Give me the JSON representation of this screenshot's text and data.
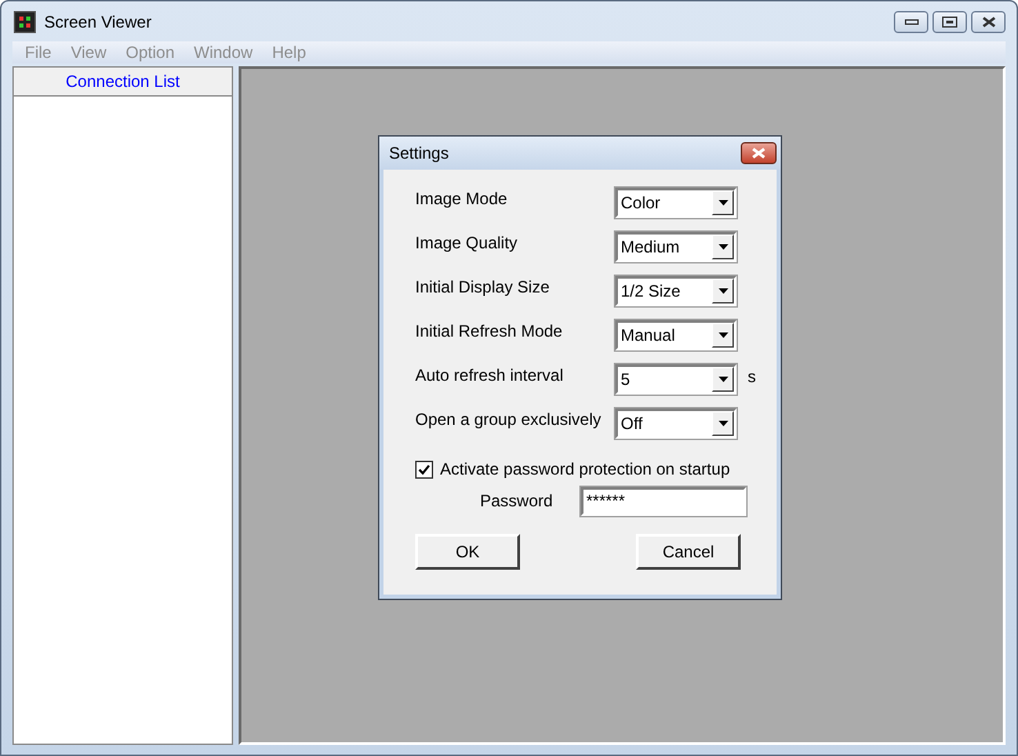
{
  "window": {
    "title": "Screen Viewer"
  },
  "menu": [
    {
      "label": "File",
      "disabled": true
    },
    {
      "label": "View",
      "disabled": true
    },
    {
      "label": "Option",
      "disabled": true
    },
    {
      "label": "Window",
      "disabled": true
    },
    {
      "label": "Help",
      "disabled": true
    }
  ],
  "connection_list": {
    "title": "Connection List"
  },
  "dialog": {
    "title": "Settings",
    "fields": [
      {
        "label": "Image Mode",
        "value": "Color"
      },
      {
        "label": "Image Quality",
        "value": "Medium"
      },
      {
        "label": "Initial Display Size",
        "value": "1/2 Size"
      },
      {
        "label": "Initial Refresh Mode",
        "value": "Manual"
      },
      {
        "label": "Auto refresh interval",
        "value": "5",
        "unit": "s"
      },
      {
        "label": "Open a group exclusively",
        "value": "Off"
      }
    ],
    "checkbox": {
      "label": "Activate password protection on startup",
      "checked": true
    },
    "password": {
      "label": "Password",
      "value": "******"
    },
    "buttons": [
      "OK",
      "Cancel"
    ]
  }
}
